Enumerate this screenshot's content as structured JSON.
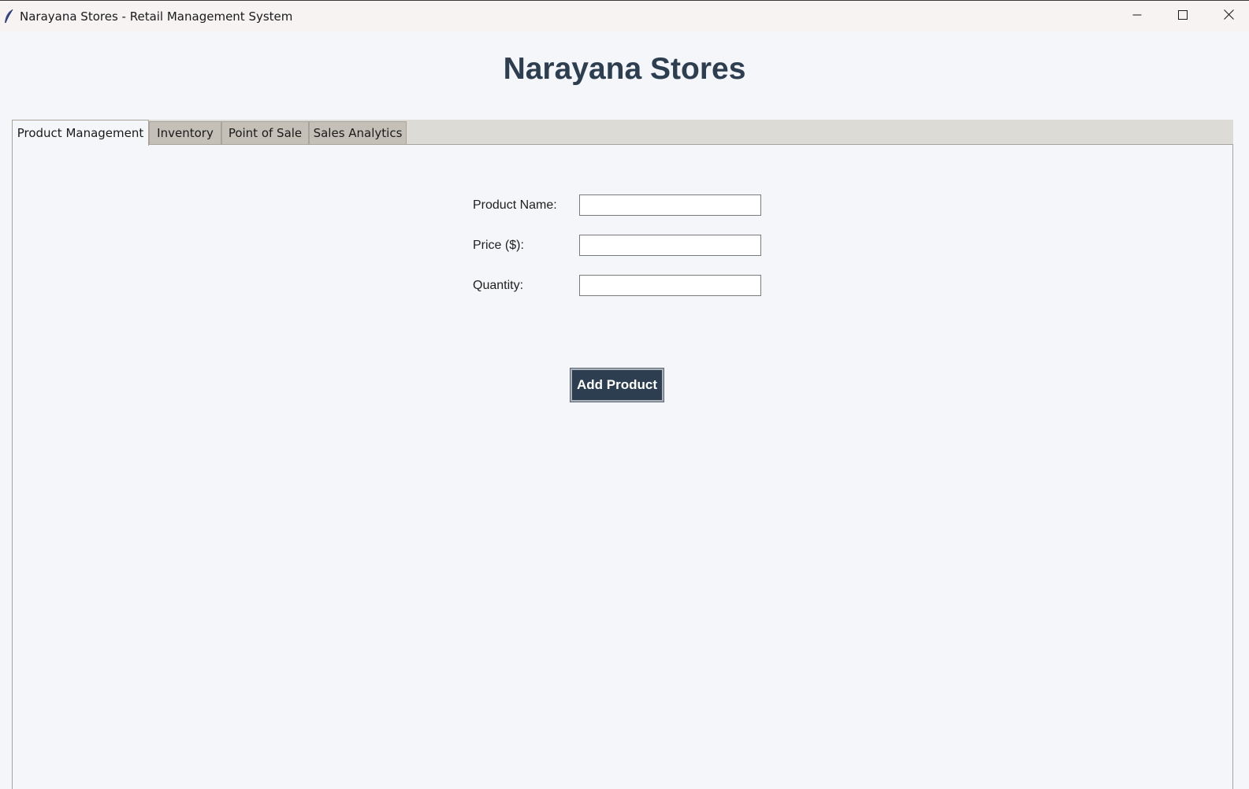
{
  "window": {
    "title": "Narayana Stores - Retail Management System",
    "icon": "feather-icon",
    "controls": [
      "minimize-icon",
      "maximize-icon",
      "close-icon"
    ]
  },
  "app": {
    "heading": "Narayana Stores",
    "heading_color": "#2c3e50"
  },
  "tabs": [
    {
      "label": "Product Management",
      "active": true
    },
    {
      "label": "Inventory",
      "active": false
    },
    {
      "label": "Point of Sale",
      "active": false
    },
    {
      "label": "Sales Analytics",
      "active": false
    }
  ],
  "form": {
    "fields": [
      {
        "label": "Product Name:",
        "value": ""
      },
      {
        "label": "Price ($):",
        "value": ""
      },
      {
        "label": "Quantity:",
        "value": ""
      }
    ],
    "submit_label": "Add Product",
    "submit_color": "#2c3e50"
  }
}
